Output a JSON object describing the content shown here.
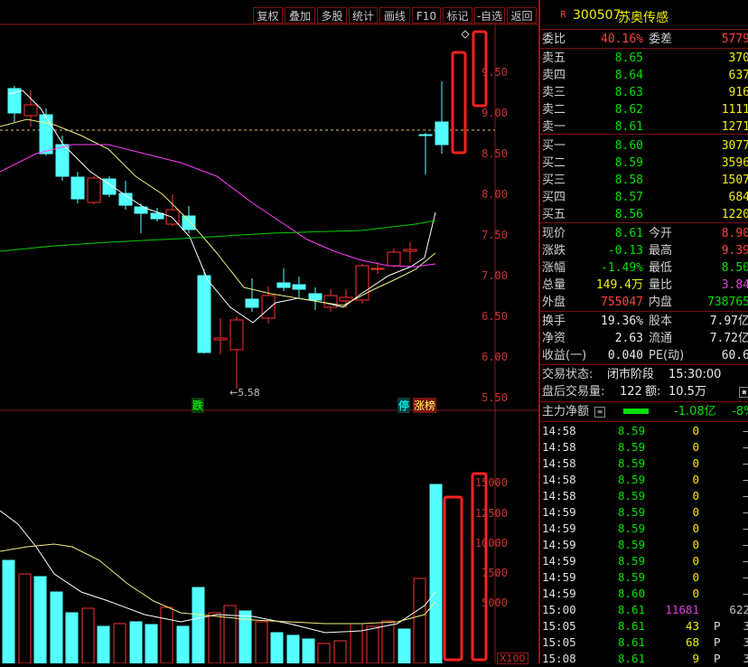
{
  "toolbar": {
    "buttons": [
      "复权",
      "叠加",
      "多股",
      "统计",
      "画线",
      "F10",
      "标记",
      "-自选",
      "返回"
    ]
  },
  "chart": {
    "price_axis": [
      "9.50",
      "9.00",
      "8.50",
      "8.00",
      "7.50",
      "7.00",
      "6.50",
      "6.00",
      "5.50"
    ],
    "volume_axis": [
      "15000",
      "12500",
      "10000",
      "7500",
      "5000"
    ],
    "volume_unit": "X100",
    "low_marker": "5.58",
    "tag_die": "跌",
    "tag_ting": "停",
    "tag_zhangbang": "涨榜",
    "colors": {
      "up": "#ff3030",
      "down": "#54ffff",
      "ma5": "#ffffff",
      "ma10": "#f0f080",
      "ma20": "#ff40ff",
      "ma60": "#00d000"
    }
  },
  "stock": {
    "code": "300507",
    "name": "苏奥传感",
    "flag": "R"
  },
  "quote": {
    "weibi_label": "委比",
    "weibi": "40.16%",
    "weicha_label": "委差",
    "weicha": "5779",
    "asks": [
      {
        "label": "卖五",
        "price": "8.65",
        "vol": "370"
      },
      {
        "label": "卖四",
        "price": "8.64",
        "vol": "637"
      },
      {
        "label": "卖三",
        "price": "8.63",
        "vol": "916"
      },
      {
        "label": "卖二",
        "price": "8.62",
        "vol": "1111"
      },
      {
        "label": "卖一",
        "price": "8.61",
        "vol": "1271"
      }
    ],
    "bids": [
      {
        "label": "买一",
        "price": "8.60",
        "vol": "3077"
      },
      {
        "label": "买二",
        "price": "8.59",
        "vol": "3596"
      },
      {
        "label": "买三",
        "price": "8.58",
        "vol": "1507"
      },
      {
        "label": "买四",
        "price": "8.57",
        "vol": "684"
      },
      {
        "label": "买五",
        "price": "8.56",
        "vol": "1220"
      }
    ],
    "stats": [
      {
        "l1": "现价",
        "v1": "8.61",
        "c1": "green",
        "l2": "今开",
        "v2": "8.90",
        "c2": "red"
      },
      {
        "l1": "涨跌",
        "v1": "-0.13",
        "c1": "green",
        "l2": "最高",
        "v2": "9.39",
        "c2": "red"
      },
      {
        "l1": "涨幅",
        "v1": "-1.49%",
        "c1": "green",
        "l2": "最低",
        "v2": "8.50",
        "c2": "green"
      },
      {
        "l1": "总量",
        "v1": "149.4万",
        "c1": "yellow",
        "l2": "量比",
        "v2": "3.84",
        "c2": "purple"
      },
      {
        "l1": "外盘",
        "v1": "755047",
        "c1": "red",
        "l2": "内盘",
        "v2": "738765",
        "c2": "green"
      }
    ],
    "stats2": [
      {
        "l1": "换手",
        "v1": "19.36%",
        "l2": "股本",
        "v2": "7.97亿"
      },
      {
        "l1": "净资",
        "v1": "2.63",
        "l2": "流通",
        "v2": "7.72亿"
      },
      {
        "l1": "收益(一)",
        "v1": "0.040",
        "l2": "PE(动)",
        "v2": "60.6"
      }
    ],
    "trade_status_label": "交易状态:",
    "trade_status": "闭市阶段",
    "trade_time": "15:30:00",
    "after_hours_label": "盘后交易量:",
    "after_hours_vol": "122",
    "after_hours_amt_label": "额:",
    "after_hours_amt": "10.5万",
    "main_flow_label": "主力净额",
    "main_flow_value": "-1.08亿",
    "main_flow_pct": "-8%"
  },
  "ticks": [
    {
      "t": "14:58",
      "p": "8.59",
      "v": "0",
      "f": "",
      "n": "—",
      "pc": "green",
      "vc": "yellow"
    },
    {
      "t": "14:58",
      "p": "8.59",
      "v": "0",
      "f": "",
      "n": "—",
      "pc": "green",
      "vc": "yellow"
    },
    {
      "t": "14:58",
      "p": "8.59",
      "v": "0",
      "f": "",
      "n": "—",
      "pc": "green",
      "vc": "yellow"
    },
    {
      "t": "14:58",
      "p": "8.59",
      "v": "0",
      "f": "",
      "n": "—",
      "pc": "green",
      "vc": "yellow"
    },
    {
      "t": "14:58",
      "p": "8.59",
      "v": "0",
      "f": "",
      "n": "—",
      "pc": "green",
      "vc": "yellow"
    },
    {
      "t": "14:59",
      "p": "8.59",
      "v": "0",
      "f": "",
      "n": "—",
      "pc": "green",
      "vc": "yellow"
    },
    {
      "t": "14:59",
      "p": "8.59",
      "v": "0",
      "f": "",
      "n": "—",
      "pc": "green",
      "vc": "yellow"
    },
    {
      "t": "14:59",
      "p": "8.59",
      "v": "0",
      "f": "",
      "n": "—",
      "pc": "green",
      "vc": "yellow"
    },
    {
      "t": "14:59",
      "p": "8.59",
      "v": "0",
      "f": "",
      "n": "—",
      "pc": "green",
      "vc": "yellow"
    },
    {
      "t": "14:59",
      "p": "8.59",
      "v": "0",
      "f": "",
      "n": "—",
      "pc": "green",
      "vc": "yellow"
    },
    {
      "t": "14:59",
      "p": "8.60",
      "v": "0",
      "f": "",
      "n": "—",
      "pc": "green",
      "vc": "yellow"
    },
    {
      "t": "15:00",
      "p": "8.61",
      "v": "11681",
      "f": "",
      "n": "622",
      "pc": "green",
      "vc": "purple"
    },
    {
      "t": "15:05",
      "p": "8.61",
      "v": "43",
      "f": "P",
      "n": "3",
      "pc": "green",
      "vc": "yellow"
    },
    {
      "t": "15:05",
      "p": "8.61",
      "v": "68",
      "p2": "",
      "f": "P",
      "n": "3",
      "pc": "green",
      "vc": "yellow"
    },
    {
      "t": "15:08",
      "p": "8.61",
      "v": "9",
      "f": "P",
      "n": "3",
      "pc": "green",
      "vc": "yellow"
    }
  ]
}
